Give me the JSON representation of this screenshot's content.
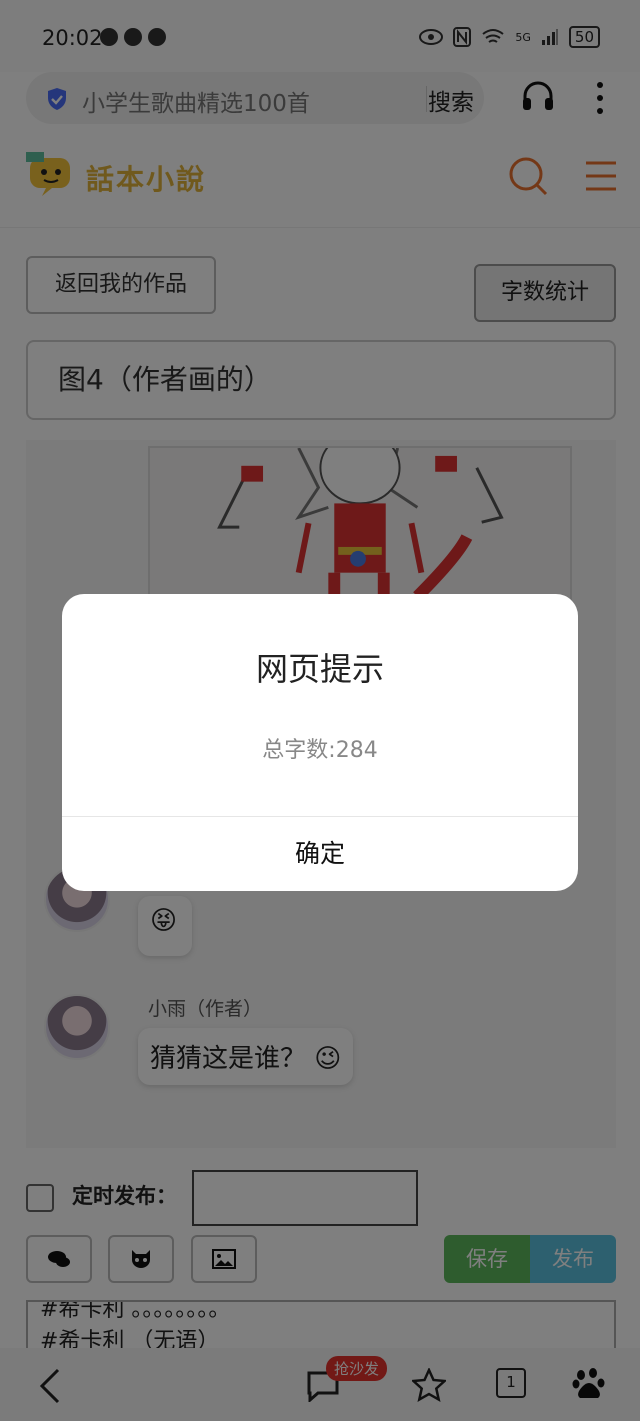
{
  "status_bar": {
    "time": "20:02",
    "signal": "5G",
    "battery": "50"
  },
  "browser": {
    "search_query": "小学生歌曲精选100首",
    "search_button": "搜索"
  },
  "site": {
    "logo_text": "話本小說"
  },
  "page": {
    "back_button": "返回我的作品",
    "word_count_button": "字数统计",
    "chapter_title": "图4（作者画的）"
  },
  "chat": {
    "messages": [
      {
        "emoji": "😝"
      },
      {
        "speaker": "小雨（作者）",
        "text": "猜猜这是谁？",
        "emoji": "😉"
      }
    ]
  },
  "publish": {
    "schedule_label": "定时发布：",
    "schedule_value": "",
    "save_button": "保存",
    "publish_button": "发布"
  },
  "editor": {
    "lines": [
      "#希卡利 。。。。。。。。",
      "#希卡利 （无语）"
    ]
  },
  "bottom_nav": {
    "comment_badge": "抢沙发",
    "tabs_count": "1"
  },
  "dialog": {
    "title": "网页提示",
    "message": "总字数:284",
    "ok_button": "确定"
  },
  "colors": {
    "save": "#5cb85c",
    "publish": "#5bc0de",
    "logo": "#e0b23a",
    "accent": "#e8712e"
  }
}
